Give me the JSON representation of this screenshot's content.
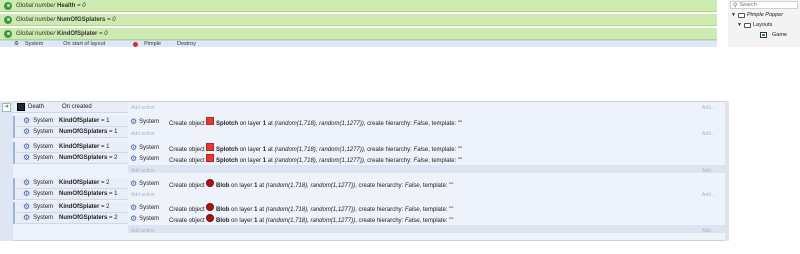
{
  "globals": [
    {
      "prefix": "Global number",
      "name": "Health",
      "suffix": "= 0"
    },
    {
      "prefix": "Global number",
      "name": "NumOfGSplaters",
      "suffix": "= 0"
    },
    {
      "prefix": "Global number",
      "name": "KindOfSplater",
      "suffix": "= 0"
    }
  ],
  "peek_row": {
    "obj": "System",
    "cond": "On start of layout",
    "action_obj": "Pimple",
    "action": "Destroy"
  },
  "project": {
    "search_placeholder": "Search",
    "root": "Pimple Popper",
    "layouts": "Layouts",
    "game": "Game"
  },
  "event": {
    "object": "Death",
    "trigger": "On created",
    "add_action": "Add action",
    "add": "Add...",
    "sub_events": [
      {
        "conditions": [
          {
            "obj": "System",
            "var": "KindOfSplater",
            "op": "= 1"
          },
          {
            "obj": "System",
            "var": "NumOfGSplaters",
            "op": "= 1"
          }
        ],
        "actions": [
          {
            "obj": "System",
            "sprite": "square",
            "pre": "Create object",
            "target": "Splotch",
            "mid": "on layer",
            "layer": "1",
            "at": "at",
            "args": "(random(1,718), random(1,1277))",
            "rest": ", create hierarchy:",
            "flag": "False",
            "tail": ", template: \"\""
          }
        ]
      },
      {
        "conditions": [
          {
            "obj": "System",
            "var": "KindOfSplater",
            "op": "= 1"
          },
          {
            "obj": "System",
            "var": "NumOfGSplaters",
            "op": "= 2"
          }
        ],
        "actions": [
          {
            "obj": "System",
            "sprite": "square",
            "pre": "Create object",
            "target": "Splotch",
            "mid": "on layer",
            "layer": "1",
            "at": "at",
            "args": "(random(1,718), random(1,1277))",
            "rest": ", create hierarchy:",
            "flag": "False",
            "tail": ", template: \"\""
          },
          {
            "obj": "System",
            "sprite": "square",
            "pre": "Create object",
            "target": "Splotch",
            "mid": "on layer",
            "layer": "1",
            "at": "at",
            "args": "(random(1,718), random(1,1277))",
            "rest": ", create hierarchy:",
            "flag": "False",
            "tail": ", template: \"\""
          }
        ]
      },
      {
        "conditions": [
          {
            "obj": "System",
            "var": "KindOfSplater",
            "op": "= 2"
          },
          {
            "obj": "System",
            "var": "NumOfGSplaters",
            "op": "= 1"
          }
        ],
        "actions": [
          {
            "obj": "System",
            "sprite": "blob",
            "pre": "Create object",
            "target": "Blob",
            "mid": "on layer",
            "layer": "1",
            "at": "at",
            "args": "(random(1,718), random(1,1277))",
            "rest": ", create hierarchy:",
            "flag": "False",
            "tail": ", template: \"\""
          }
        ]
      },
      {
        "conditions": [
          {
            "obj": "System",
            "var": "KindOfSplater",
            "op": "= 2"
          },
          {
            "obj": "System",
            "var": "NumOfGSplaters",
            "op": "= 2"
          }
        ],
        "actions": [
          {
            "obj": "System",
            "sprite": "blob",
            "pre": "Create object",
            "target": "Blob",
            "mid": "on layer",
            "layer": "1",
            "at": "at",
            "args": "(random(1,718), random(1,1277))",
            "rest": ", create hierarchy:",
            "flag": "False",
            "tail": ", template: \"\""
          },
          {
            "obj": "System",
            "sprite": "blob",
            "pre": "Create object",
            "target": "Blob",
            "mid": "on layer",
            "layer": "1",
            "at": "at",
            "args": "(random(1,718), random(1,1277))",
            "rest": ", create hierarchy:",
            "flag": "False",
            "tail": ", template: \"\""
          }
        ]
      }
    ]
  }
}
